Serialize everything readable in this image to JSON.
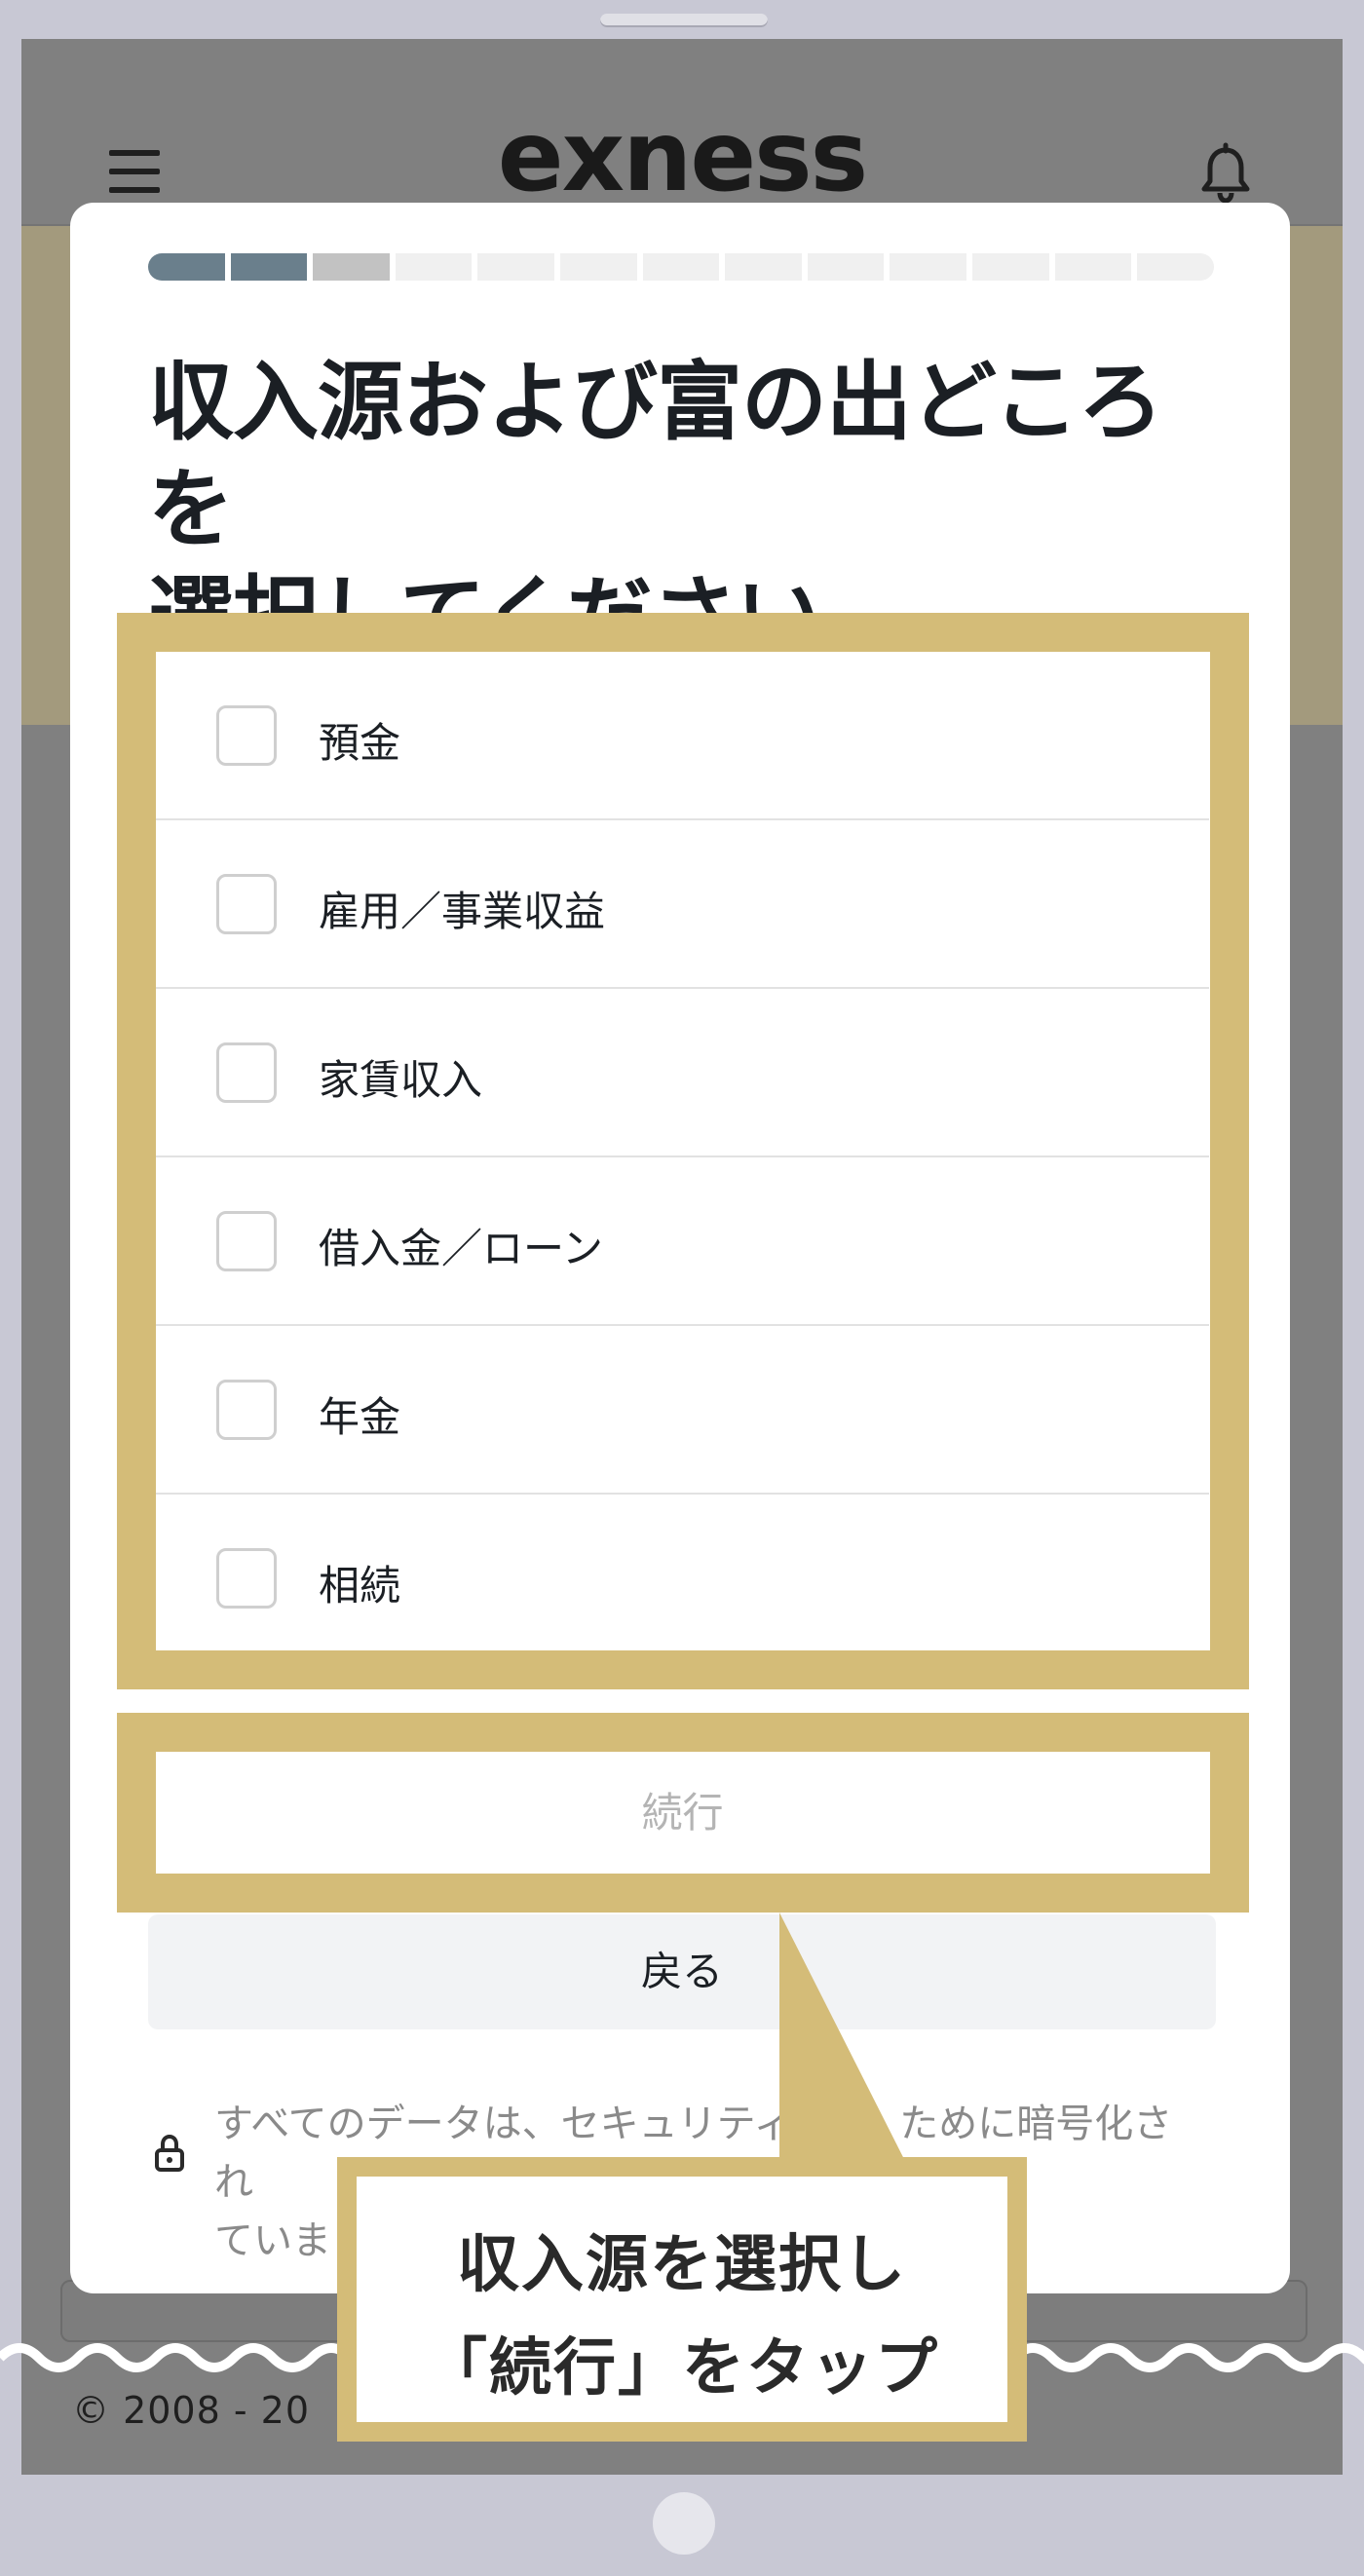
{
  "header": {
    "logo_text": "exness",
    "menu_icon": "hamburger-menu-icon",
    "notification_icon": "bell-icon"
  },
  "progress": {
    "total_steps": 13,
    "completed_steps": 2,
    "current_step": 3,
    "colors": {
      "done": "#6a7f8c",
      "current": "#c2c2c2",
      "todo": "#f0f0f0"
    }
  },
  "modal": {
    "title_line1": "収入源および富の出どころを",
    "title_line2": "選択してください",
    "options": [
      {
        "label": "預金",
        "checked": false
      },
      {
        "label": "雇用／事業収益",
        "checked": false
      },
      {
        "label": "家賃収入",
        "checked": false
      },
      {
        "label": "借入金／ローン",
        "checked": false
      },
      {
        "label": "年金",
        "checked": false
      },
      {
        "label": "相続",
        "checked": false
      }
    ],
    "continue_label": "続行",
    "back_label": "戻る",
    "security_note_line1": "すべてのデータは、セキュリティ対",
    "security_note_line1_end": "ために暗号化され",
    "security_note_line2": "ていま"
  },
  "footer": {
    "copyright": "© 2008 - 20"
  },
  "annotation": {
    "line1": "収入源を選択し",
    "line2": "「続行」をタップ",
    "highlight_color": "#d4bc78"
  }
}
